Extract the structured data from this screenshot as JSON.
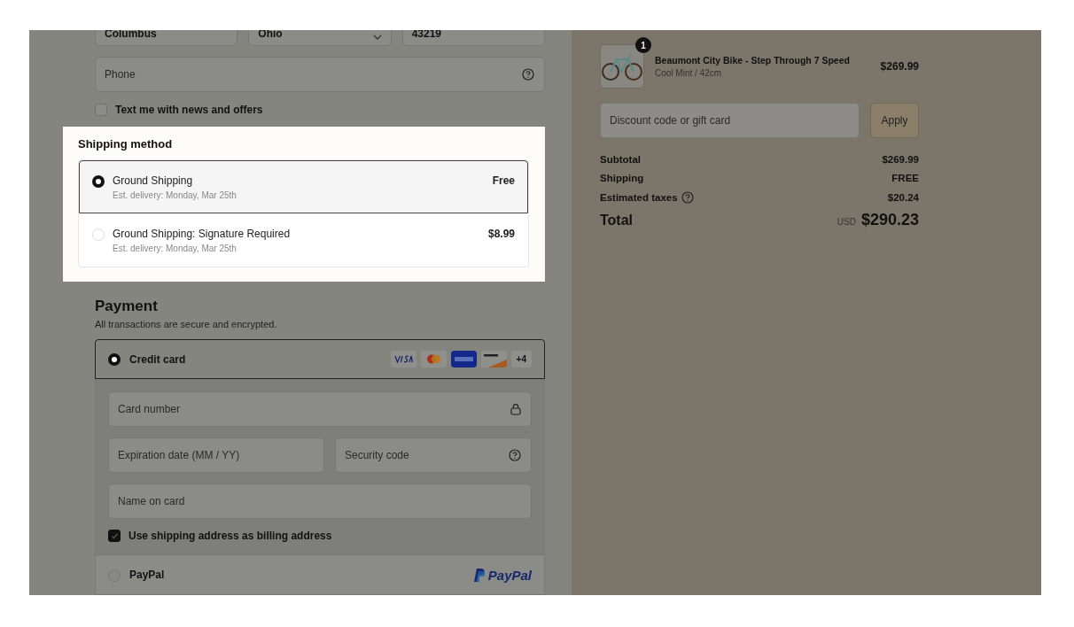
{
  "address_fields": [
    {
      "value": "Columbus",
      "kind": "text"
    },
    {
      "value": "Ohio",
      "kind": "select"
    },
    {
      "value": "43219",
      "kind": "text"
    }
  ],
  "phone": {
    "placeholder": "Phone"
  },
  "marketing_opt_in": {
    "label": "Text me with news and offers",
    "checked": false
  },
  "shipping_method": {
    "title": "Shipping method",
    "options": [
      {
        "name": "Ground Shipping",
        "delivery": "Est. delivery:  Monday, Mar 25th",
        "price": "Free",
        "selected": true
      },
      {
        "name": "Ground Shipping: Signature Required",
        "delivery": "Est. delivery:  Monday, Mar 25th",
        "price": "$8.99",
        "selected": false
      }
    ]
  },
  "payment": {
    "title": "Payment",
    "subtitle": "All transactions are secure and encrypted.",
    "methods": [
      {
        "kind": "card",
        "label": "Credit card",
        "selected": true,
        "more_brands": "+4",
        "card_number": {
          "placeholder": "Card number"
        },
        "expiration": {
          "placeholder": "Expiration date (MM / YY)"
        },
        "security_code": {
          "placeholder": "Security code"
        },
        "name_on_card": {
          "placeholder": "Name on card"
        },
        "billing_same": {
          "label": "Use shipping address as billing address",
          "checked": true
        }
      },
      {
        "kind": "paypal",
        "label": "PayPal",
        "selected": false,
        "logo_text": "PayPal"
      }
    ]
  },
  "order": {
    "item": {
      "quantity": "1",
      "name": "Beaumont City Bike - Step Through 7 Speed",
      "variant": "Cool Mint / 42cm",
      "price": "$269.99"
    },
    "discount": {
      "placeholder": "Discount code or gift card",
      "button": "Apply"
    },
    "lines": [
      {
        "label": "Subtotal",
        "value": "$269.99",
        "info": false
      },
      {
        "label": "Shipping",
        "value": "FREE",
        "info": false
      },
      {
        "label": "Estimated taxes",
        "value": "$20.24",
        "info": true
      }
    ],
    "total": {
      "label": "Total",
      "currency": "USD",
      "amount": "$290.23"
    }
  }
}
